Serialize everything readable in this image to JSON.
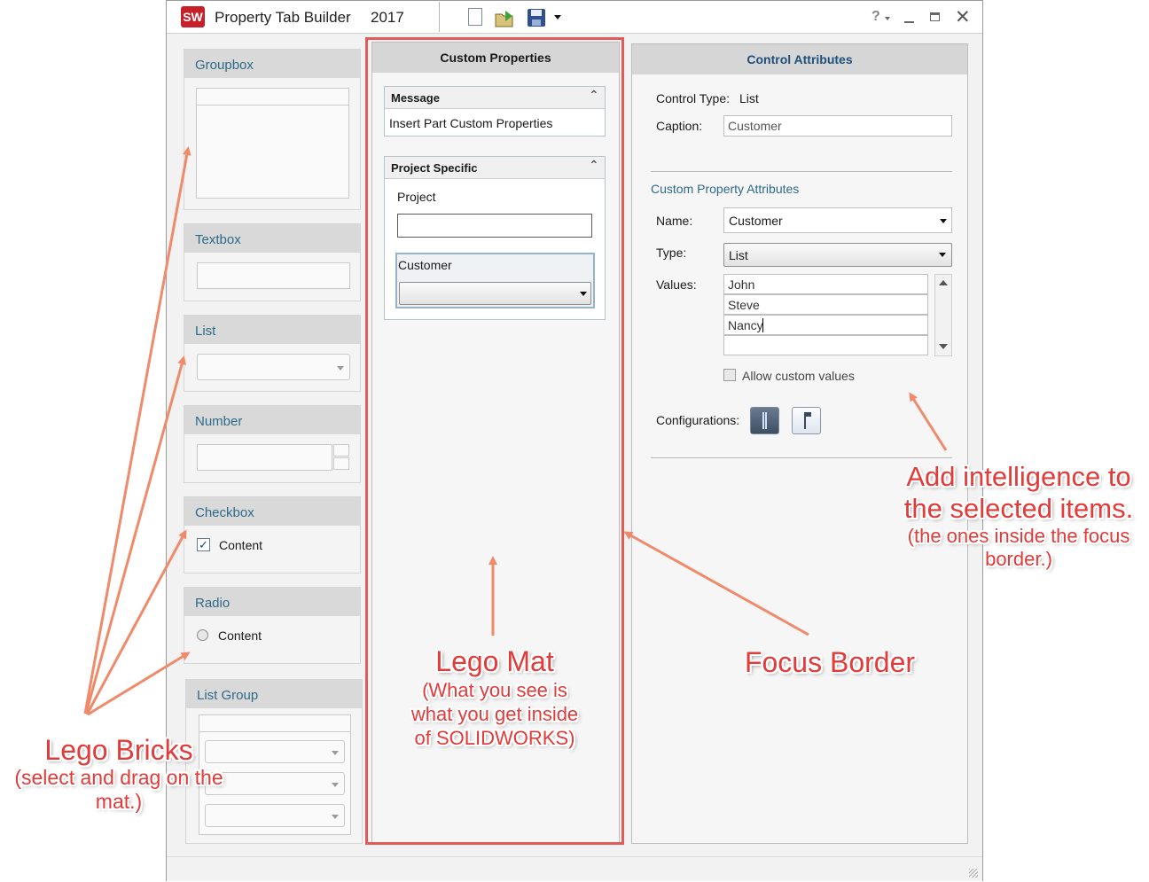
{
  "window": {
    "title": "Property Tab Builder",
    "year": "2017"
  },
  "palette": {
    "groupbox": "Groupbox",
    "textbox": "Textbox",
    "list": "List",
    "number": "Number",
    "checkbox": "Checkbox",
    "checkbox_content": "Content",
    "radio": "Radio",
    "radio_content": "Content",
    "list_group": "List Group"
  },
  "custom_properties": {
    "title": "Custom Properties",
    "message": {
      "header": "Message",
      "text": "Insert Part Custom Properties"
    },
    "project_specific": {
      "header": "Project Specific",
      "project_label": "Project",
      "project_value": "",
      "customer_label": "Customer",
      "customer_value": ""
    }
  },
  "control_attributes": {
    "title": "Control Attributes",
    "control_type_label": "Control Type:",
    "control_type_value": "List",
    "caption_label": "Caption:",
    "caption_value": "Customer",
    "section_title": "Custom Property Attributes",
    "name_label": "Name:",
    "name_value": "Customer",
    "type_label": "Type:",
    "type_value": "List",
    "values_label": "Values:",
    "values": [
      "John",
      "Steve",
      "Nancy",
      ""
    ],
    "allow_custom": "Allow custom values",
    "allow_custom_checked": false,
    "configurations_label": "Configurations:"
  },
  "annotations": {
    "lego_bricks_title": "Lego Bricks",
    "lego_bricks_sub": "(select and drag on the mat.)",
    "lego_mat_title": "Lego Mat",
    "lego_mat_sub": "(What you see is what you get inside of SOLIDWORKS)",
    "focus_border": "Focus Border",
    "add_intel_title": "Add intelligence to the selected items.",
    "add_intel_sub": "(the ones inside the focus border.)"
  },
  "colors": {
    "annotation": "#e33a3a",
    "arrow": "#f08a6a",
    "focus_border": "#e35a5a",
    "accent_text": "#2d6a8a"
  }
}
